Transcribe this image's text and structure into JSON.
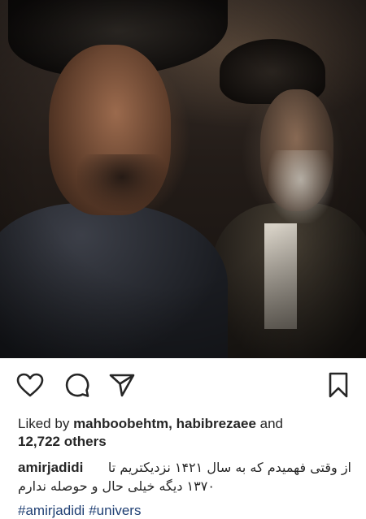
{
  "post": {
    "image_icon": "film-still-photo"
  },
  "actions": {
    "like_icon": "heart-icon",
    "comment_icon": "comment-bubble-icon",
    "share_icon": "paper-plane-icon",
    "save_icon": "bookmark-icon"
  },
  "likes": {
    "prefix": "Liked by",
    "user1": "mahboobehtm,",
    "user2": "habibrezaee",
    "connector": "and",
    "count": "12,722 others"
  },
  "caption": {
    "username": "amirjadidi",
    "text_line1": "از وقتی فهمیدم که به سال ۱۴۲۱ نزدیکتریم تا",
    "text_line2": "۱۳۷۰ دیگه خیلی حال و حوصله ندارم"
  },
  "hashtags": [
    "#amirjadidi",
    "#univers"
  ],
  "colors": {
    "text": "#262626",
    "hashtag": "#1f3f73",
    "background": "#ffffff"
  }
}
